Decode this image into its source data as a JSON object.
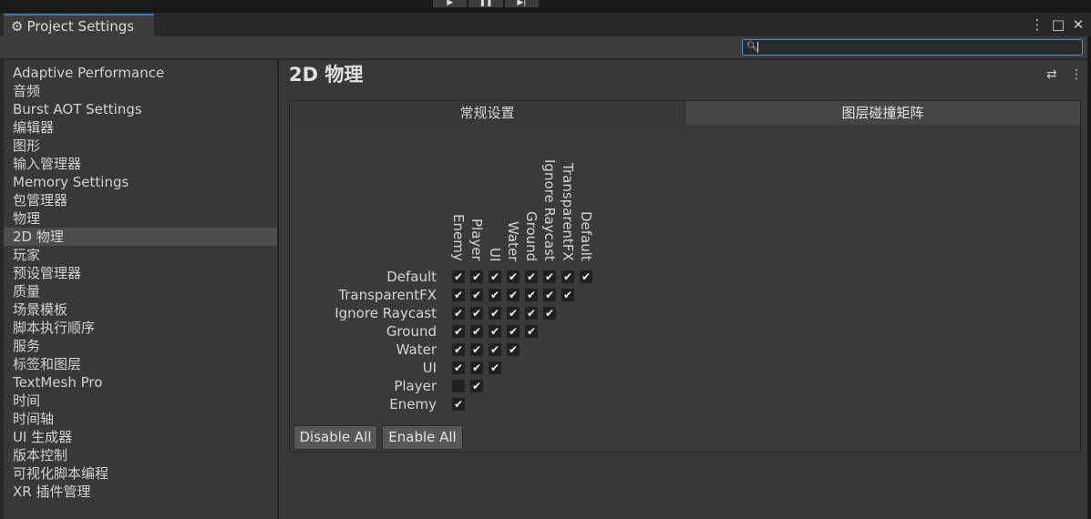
{
  "window": {
    "tab_title": "Project Settings",
    "controls": [
      "⋮",
      "□",
      "✕"
    ]
  },
  "sidebar": {
    "items": [
      "Adaptive Performance",
      "音频",
      "Burst AOT Settings",
      "编辑器",
      "图形",
      "输入管理器",
      "Memory Settings",
      "包管理器",
      "物理",
      "2D 物理",
      "玩家",
      "预设管理器",
      "质量",
      "场景模板",
      "脚本执行顺序",
      "服务",
      "标签和图层",
      "TextMesh Pro",
      "时间",
      "时间轴",
      "UI 生成器",
      "版本控制",
      "可视化脚本编程",
      "XR 插件管理"
    ],
    "selected": "2D 物理"
  },
  "main": {
    "title": "2D 物理",
    "tabs": [
      "常规设置",
      "图层碰撞矩阵"
    ],
    "active_tab": "图层碰撞矩阵"
  },
  "matrix": {
    "layers": [
      "Default",
      "TransparentFX",
      "Ignore Raycast",
      "Ground",
      "Water",
      "UI",
      "Player",
      "Enemy"
    ],
    "columns": [
      "Enemy",
      "Player",
      "UI",
      "Water",
      "Ground",
      "Ignore Raycast",
      "TransparentFX",
      "Default"
    ],
    "checked": [
      [
        true,
        true,
        true,
        true,
        true,
        true,
        true,
        true
      ],
      [
        true,
        true,
        true,
        true,
        true,
        true,
        true
      ],
      [
        true,
        true,
        true,
        true,
        true,
        true
      ],
      [
        true,
        true,
        true,
        true,
        true
      ],
      [
        true,
        true,
        true,
        true
      ],
      [
        true,
        true,
        true
      ],
      [
        false,
        true
      ],
      [
        true
      ]
    ]
  },
  "buttons": {
    "disable_all": "Disable All",
    "enable_all": "Enable All"
  }
}
